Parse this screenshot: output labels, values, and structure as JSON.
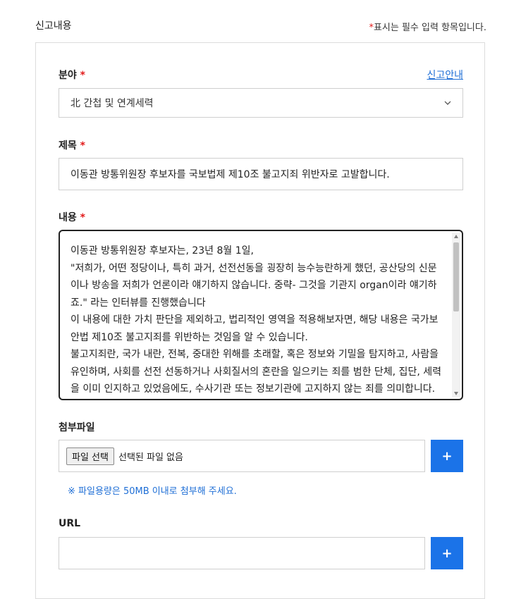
{
  "header": {
    "title": "신고내용",
    "required_star": "*",
    "required_note": "표시는 필수 입력 항목입니다."
  },
  "category": {
    "label": "분야",
    "star": "*",
    "guide_link": "신고안내",
    "selected": "北 간첩 및 연계세력"
  },
  "subject": {
    "label": "제목",
    "star": "*",
    "value": "이동관 방통위원장 후보자를 국보법제 제10조 불고지죄 위반자로 고발합니다."
  },
  "content": {
    "label": "내용",
    "star": "*",
    "value": "이동관 방통위원장 후보자는, 23년 8월 1일,\n\"저희가, 어떤 정당이나, 특히 과거, 선전선동을 굉장히 능수능란하게 했던, 공산당의 신문이나 방송을 저희가 언론이라 얘기하지 않습니다. 중략- 그것을 기관지 organ이라 얘기하죠.\" 라는 인터뷰를 진행했습니다\n이 내용에 대한 가치 판단을 제외하고, 법리적인 영역을 적용해보자면, 해당 내용은 국가보안법 제10조 불고지죄를 위반하는 것임을 알 수 있습니다.\n불고지죄란, 국가 내란, 전복, 중대한 위해를 초래할, 혹은 정보와 기밀을 탐지하고, 사람을 유인하며, 사회를 선전 선동하거나 사회질서의 혼란을 일으키는 죄를 범한 단체, 집단, 세력을 이미 인지하고 있었음에도, 수사기관 또는 정보기관에 고지하지 않는 죄를 의미합니다."
  },
  "attachment": {
    "label": "첨부파일",
    "choose_button": "파일 선택",
    "no_file_text": "선택된 파일 없음",
    "add_symbol": "+",
    "size_note": "※ 파일용량은 50MB 이내로 첨부해 주세요."
  },
  "url": {
    "label": "URL",
    "value": "",
    "add_symbol": "+"
  },
  "colors": {
    "accent": "#1b73e8",
    "required": "#e21b1b",
    "link": "#1f6fd6"
  }
}
